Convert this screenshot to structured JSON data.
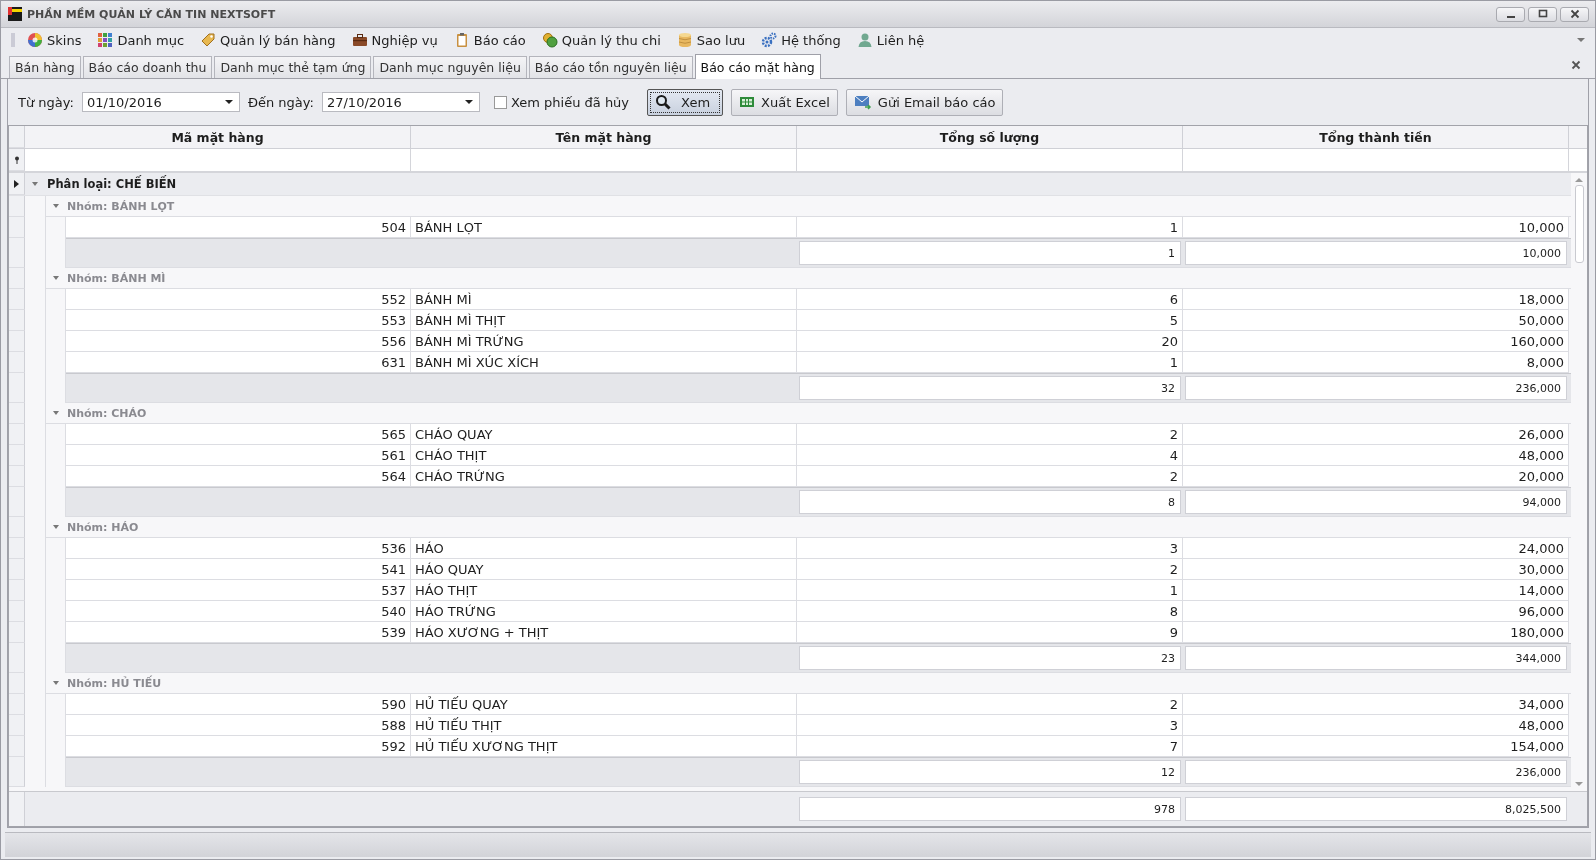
{
  "window": {
    "title": "PHẦN MỀM QUẢN LÝ CĂN TIN NEXTSOFT"
  },
  "menu": [
    {
      "label": "Skins"
    },
    {
      "label": "Danh mục"
    },
    {
      "label": "Quản lý bán hàng"
    },
    {
      "label": "Nghiệp vụ"
    },
    {
      "label": "Báo cáo"
    },
    {
      "label": "Quản lý thu chi"
    },
    {
      "label": "Sao lưu"
    },
    {
      "label": "Hệ thống"
    },
    {
      "label": "Liên hệ"
    }
  ],
  "tabs": [
    {
      "label": "Bán hàng",
      "selected": false
    },
    {
      "label": "Báo cáo doanh thu",
      "selected": false
    },
    {
      "label": "Danh mục thẻ tạm ứng",
      "selected": false
    },
    {
      "label": "Danh mục nguyên liệu",
      "selected": false
    },
    {
      "label": "Báo cáo tồn nguyên liệu",
      "selected": false
    },
    {
      "label": "Báo cáo mặt hàng",
      "selected": true
    }
  ],
  "filter": {
    "from_label": "Từ ngày:",
    "from_value": "01/10/2016",
    "to_label": "Đến ngày:",
    "to_value": "27/10/2016",
    "show_cancelled": {
      "label": "Xem phiếu đã hủy",
      "checked": false
    },
    "buttons": [
      {
        "label": "Xem",
        "kind": "search",
        "focused": true
      },
      {
        "label": "Xuất Excel",
        "kind": "excel",
        "focused": false
      },
      {
        "label": "Gửi Email báo cáo",
        "kind": "email",
        "focused": false
      }
    ]
  },
  "grid": {
    "columns": [
      "Mã mặt hàng",
      "Tên mặt hàng",
      "Tổng số lượng",
      "Tổng thành tiền"
    ],
    "category": {
      "label": "Phân loại: CHẾ BIẾN",
      "expanded": true,
      "groups": [
        {
          "label": "Nhóm: BÁNH LỌT",
          "expanded": true,
          "rows": [
            {
              "code": "504",
              "name": "BÁNH LỌT",
              "qty": "1",
              "amount": "10,000"
            }
          ],
          "summary": {
            "qty": "1",
            "amount": "10,000"
          }
        },
        {
          "label": "Nhóm: BÁNH MÌ",
          "expanded": true,
          "rows": [
            {
              "code": "552",
              "name": "BÁNH MÌ",
              "qty": "6",
              "amount": "18,000"
            },
            {
              "code": "553",
              "name": "BÁNH MÌ THỊT",
              "qty": "5",
              "amount": "50,000"
            },
            {
              "code": "556",
              "name": "BÁNH MÌ TRỨNG",
              "qty": "20",
              "amount": "160,000"
            },
            {
              "code": "631",
              "name": "BÁNH MÌ XÚC XÍCH",
              "qty": "1",
              "amount": "8,000"
            }
          ],
          "summary": {
            "qty": "32",
            "amount": "236,000"
          }
        },
        {
          "label": "Nhóm: CHÁO",
          "expanded": true,
          "rows": [
            {
              "code": "565",
              "name": "CHÁO QUAY",
              "qty": "2",
              "amount": "26,000"
            },
            {
              "code": "561",
              "name": "CHÁO THỊT",
              "qty": "4",
              "amount": "48,000"
            },
            {
              "code": "564",
              "name": "CHÁO TRỨNG",
              "qty": "2",
              "amount": "20,000"
            }
          ],
          "summary": {
            "qty": "8",
            "amount": "94,000"
          }
        },
        {
          "label": "Nhóm: HÁO",
          "expanded": true,
          "rows": [
            {
              "code": "536",
              "name": "HÁO",
              "qty": "3",
              "amount": "24,000"
            },
            {
              "code": "541",
              "name": "HÁO QUAY",
              "qty": "2",
              "amount": "30,000"
            },
            {
              "code": "537",
              "name": "HÁO THỊT",
              "qty": "1",
              "amount": "14,000"
            },
            {
              "code": "540",
              "name": "HÁO TRỨNG",
              "qty": "8",
              "amount": "96,000"
            },
            {
              "code": "539",
              "name": "HÁO XƯƠNG + THỊT",
              "qty": "9",
              "amount": "180,000"
            }
          ],
          "summary": {
            "qty": "23",
            "amount": "344,000"
          }
        },
        {
          "label": "Nhóm: HỦ TIẾU",
          "expanded": true,
          "rows": [
            {
              "code": "590",
              "name": "HỦ TIẾU QUAY",
              "qty": "2",
              "amount": "34,000"
            },
            {
              "code": "588",
              "name": "HỦ TIẾU THỊT",
              "qty": "3",
              "amount": "48,000"
            },
            {
              "code": "592",
              "name": "HỦ TIẾU XƯƠNG THỊT",
              "qty": "7",
              "amount": "154,000"
            }
          ],
          "summary": {
            "qty": "12",
            "amount": "236,000"
          }
        }
      ]
    },
    "total": {
      "qty": "978",
      "amount": "8,025,500"
    }
  }
}
